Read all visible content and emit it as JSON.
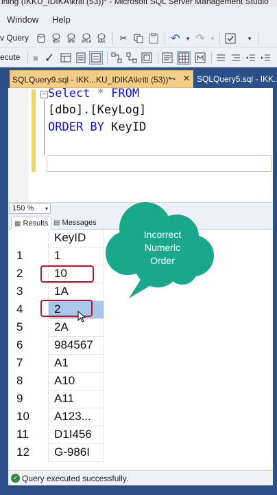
{
  "window": {
    "title": "ining (IKKU_IDIKA\\kriti (53))* - Microsoft SQL Server Management Studio"
  },
  "menu": {
    "items": [
      "Window",
      "Help"
    ]
  },
  "toolbar1": {
    "new_query_label": "v Query",
    "icon_labels": [
      "MDX",
      "DMX",
      "XMLA",
      "DAX"
    ]
  },
  "toolbar2": {
    "execute_label": "ecute"
  },
  "tabs": {
    "active": "SQLQuery9.sql - IKK...KU_IDIKA\\kriti (53))*",
    "inactive": "SQLQuery5.sql - IKK..."
  },
  "editor": {
    "line1_keyword1": "Select",
    "line1_star": "*",
    "line1_keyword2": "FROM",
    "line2": "[dbo].[KeyLog]",
    "line3_keyword": "ORDER BY",
    "line3_id": "KeyID"
  },
  "zoom": {
    "value": "150 %"
  },
  "result_tabs": {
    "results": "Results",
    "messages": "Messages"
  },
  "grid": {
    "header": "KeyID",
    "rows": [
      {
        "num": "1",
        "value": "1"
      },
      {
        "num": "2",
        "value": "10"
      },
      {
        "num": "3",
        "value": "1A"
      },
      {
        "num": "4",
        "value": "2"
      },
      {
        "num": "5",
        "value": "2A"
      },
      {
        "num": "6",
        "value": "984567"
      },
      {
        "num": "7",
        "value": "A1"
      },
      {
        "num": "8",
        "value": "A10"
      },
      {
        "num": "9",
        "value": "A11"
      },
      {
        "num": "10",
        "value": "A123..."
      },
      {
        "num": "11",
        "value": "D1I456"
      },
      {
        "num": "12",
        "value": "G-986I"
      }
    ]
  },
  "callout": {
    "line1": "Incorrect",
    "line2": "Numeric",
    "line3": "Order"
  },
  "status": {
    "message": "Query executed successfully."
  },
  "colors": {
    "accent_blue": "#2b4f89",
    "tab_active": "#f5cc84",
    "callout_teal": "#1aa88a",
    "highlight_red": "#c8102e",
    "selection": "#a9c7ea"
  }
}
